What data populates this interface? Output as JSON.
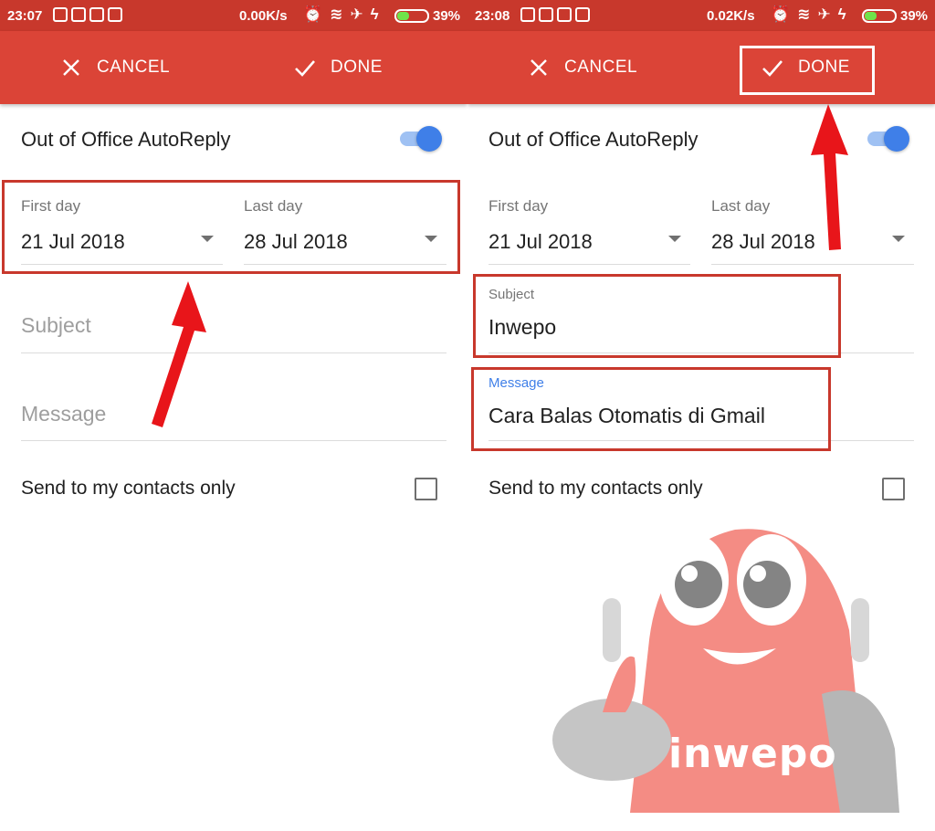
{
  "screens": [
    {
      "status": {
        "time": "23:07",
        "speed": "0.00K/s",
        "battery_pct": "39%",
        "battery_level": 0.39
      },
      "toolbar": {
        "cancel_label": "CANCEL",
        "done_label": "DONE"
      },
      "autoreply": {
        "label": "Out of Office AutoReply",
        "enabled": true
      },
      "first_day": {
        "label": "First day",
        "value": "21 Jul 2018"
      },
      "last_day": {
        "label": "Last day",
        "value": "28 Jul 2018"
      },
      "subject": {
        "placeholder": "Subject",
        "value": ""
      },
      "message": {
        "placeholder": "Message",
        "value": ""
      },
      "contacts_only": {
        "label": "Send to my contacts only",
        "checked": false
      }
    },
    {
      "status": {
        "time": "23:08",
        "speed": "0.02K/s",
        "battery_pct": "39%",
        "battery_level": 0.39
      },
      "toolbar": {
        "cancel_label": "CANCEL",
        "done_label": "DONE"
      },
      "autoreply": {
        "label": "Out of Office AutoReply",
        "enabled": true
      },
      "first_day": {
        "label": "First day",
        "value": "21 Jul 2018"
      },
      "last_day": {
        "label": "Last day",
        "value": "28 Jul 2018"
      },
      "subject": {
        "label": "Subject",
        "value": "Inwepo"
      },
      "message": {
        "label": "Message",
        "value": "Cara Balas Otomatis di Gmail"
      },
      "contacts_only": {
        "label": "Send to my contacts only",
        "checked": false
      }
    }
  ],
  "watermark": {
    "text": "inwepo"
  },
  "colors": {
    "toolbar": "#db4437",
    "statusbar": "#c8382c",
    "accent": "#3f7fe8",
    "highlight": "#c8382c",
    "arrow": "#e8151a"
  },
  "icons": {
    "cancel": "close-icon",
    "done": "check-icon",
    "dropdown": "arrow-drop-down-icon"
  }
}
